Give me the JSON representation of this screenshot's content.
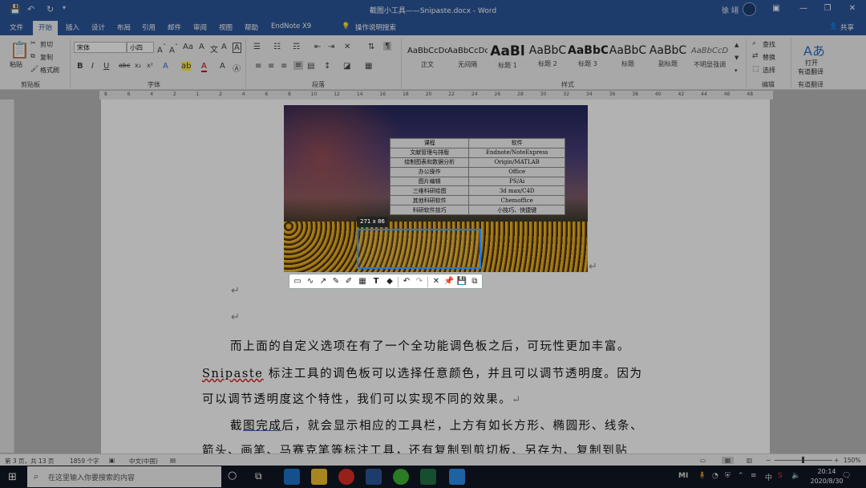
{
  "window": {
    "title": "截图小工具——Snipaste.docx - Word",
    "user": "徐 翊",
    "controls": {
      "minimize": "—",
      "restore": "❐",
      "close": "✕",
      "ribbon_opts": "▣"
    }
  },
  "tabs": [
    "文件",
    "开始",
    "插入",
    "设计",
    "布局",
    "引用",
    "邮件",
    "审阅",
    "视图",
    "帮助",
    "EndNote X9"
  ],
  "active_tab": "开始",
  "tell_me": "操作说明搜索",
  "share": "共享",
  "ribbon": {
    "clipboard": {
      "paste": "粘贴",
      "cut": "剪切",
      "copy": "复制",
      "format_painter": "格式刷",
      "label": "剪贴板"
    },
    "font": {
      "name": "宋体",
      "size": "小四",
      "label": "字体"
    },
    "paragraph": {
      "label": "段落"
    },
    "styles": {
      "label": "样式",
      "items": [
        {
          "preview": "AaBbCcDc",
          "name": "正文"
        },
        {
          "preview": "AaBbCcDc",
          "name": "无间隔"
        },
        {
          "preview": "AaBl",
          "name": "标题 1"
        },
        {
          "preview": "AaBbC",
          "name": "标题 2"
        },
        {
          "preview": "AaBbC",
          "name": "标题 3"
        },
        {
          "preview": "AaBbC",
          "name": "标题"
        },
        {
          "preview": "AaBbC",
          "name": "副标题"
        },
        {
          "preview": "AaBbCcD",
          "name": "不明显强调"
        }
      ]
    },
    "editing": {
      "find": "查找",
      "replace": "替换",
      "select": "选择",
      "label": "编辑"
    },
    "youdao": {
      "open": "打开",
      "translate": "有道翻译",
      "label": "有道翻译"
    }
  },
  "ruler_marks": [
    "8",
    "6",
    "4",
    "2",
    "1",
    "2",
    "4",
    "6",
    "8",
    "10",
    "12",
    "14",
    "16",
    "18",
    "20",
    "22",
    "24",
    "26",
    "28",
    "30",
    "32",
    "34",
    "36",
    "38",
    "40",
    "42",
    "44",
    "46",
    "48"
  ],
  "embedded_table": {
    "headers": [
      "课程",
      "软件"
    ],
    "rows": [
      [
        "文献管理与排版",
        "Endnote/NoteExpress"
      ],
      [
        "绘制图表和数据分析",
        "Origin/MATLAB"
      ],
      [
        "办公操作",
        "Office"
      ],
      [
        "图片编辑",
        "PS/Ai"
      ],
      [
        "三维科研绘图",
        "3d max/C4D"
      ],
      [
        "其他科研软件",
        "Chemoffice"
      ],
      [
        "科研软件技巧",
        "小技巧、快捷键"
      ]
    ]
  },
  "selection_size": "271 x 86",
  "toolbar_icons": [
    "rectangle-ellipse",
    "pencil-curve",
    "arrow",
    "pen",
    "marker",
    "mosaic",
    "text",
    "eraser",
    "undo",
    "redo",
    "cancel",
    "pin",
    "save",
    "copy"
  ],
  "document": {
    "para1_line1": "而上面的自定义选项在有了一个全功能调色板之后，可玩性更加丰富。",
    "para1_line2_link": "Snipaste",
    "para1_line2_rest": " 标注工具的调色板可以选择任意颜色，并且可以调节透明度。因为",
    "para1_line3": "可以调节透明度这个特性，我们可以实现不同的效果。",
    "para2_line1_a": "截",
    "para2_line1_link": "图完成",
    "para2_line1_b": "后，就会显示相应的工具栏，上方有如长方形、椭圆形、线条、",
    "para2_line2": "箭头、画笔、马赛克笔等标注工具，还有复制到剪切板、另存为、复制到贴",
    "return_mark": "↵"
  },
  "status": {
    "page": "第 3 页，共 13 页",
    "words": "1859 个字",
    "lang": "中文(中国)",
    "zoom": "150%"
  },
  "taskbar": {
    "search_placeholder": "在这里输入你要搜索的内容",
    "time": "20:14",
    "date": "2020/8/30",
    "ime": "中",
    "mi": "MI"
  }
}
